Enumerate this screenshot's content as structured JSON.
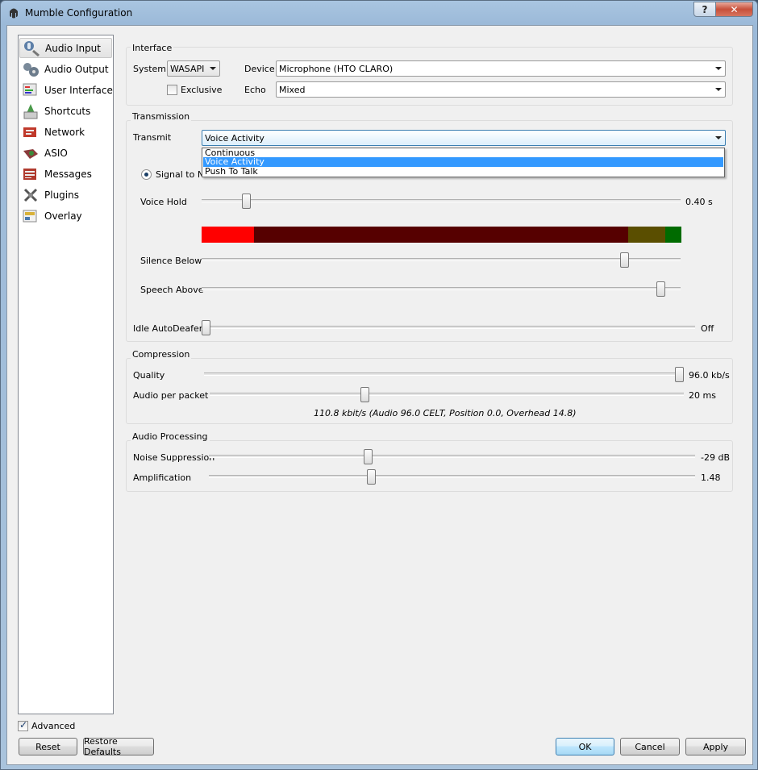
{
  "window": {
    "title": "Mumble Configuration",
    "help_glyph": "?",
    "close_glyph": "✕"
  },
  "sidebar": {
    "items": [
      {
        "label": "Audio Input",
        "icon": "audio-input-icon",
        "selected": true
      },
      {
        "label": "Audio Output",
        "icon": "audio-output-icon"
      },
      {
        "label": "User Interface",
        "icon": "user-interface-icon"
      },
      {
        "label": "Shortcuts",
        "icon": "shortcuts-icon"
      },
      {
        "label": "Network",
        "icon": "network-icon"
      },
      {
        "label": "ASIO",
        "icon": "asio-icon"
      },
      {
        "label": "Messages",
        "icon": "messages-icon"
      },
      {
        "label": "Plugins",
        "icon": "plugins-icon"
      },
      {
        "label": "Overlay",
        "icon": "overlay-icon"
      }
    ]
  },
  "interface": {
    "title": "Interface",
    "system_label": "System",
    "system_value": "WASAPI",
    "exclusive_label": "Exclusive",
    "exclusive_checked": false,
    "device_label": "Device",
    "device_value": "Microphone (HTO CLARO)",
    "echo_label": "Echo",
    "echo_value": "Mixed"
  },
  "transmission": {
    "title": "Transmission",
    "transmit_label": "Transmit",
    "transmit_value": "Voice Activity",
    "transmit_options": [
      "Continuous",
      "Voice Activity",
      "Push To Talk"
    ],
    "transmit_selected_index": 1,
    "signal_label": "Signal to No",
    "voice_hold_label": "Voice Hold",
    "voice_hold_value": "0.40 s",
    "silence_below_label": "Silence Below",
    "speech_above_label": "Speech Above",
    "idle_label": "Idle AutoDeafen",
    "idle_value": "Off",
    "meter_colors": {
      "active": "#ff0000",
      "silence": "#560000",
      "between": "#5a4e00",
      "speech": "#006b00"
    }
  },
  "compression": {
    "title": "Compression",
    "quality_label": "Quality",
    "quality_value": "96.0 kb/s",
    "packet_label": "Audio per packet",
    "packet_value": "20 ms",
    "summary": "110.8 kbit/s (Audio 96.0 CELT, Position 0.0, Overhead 14.8)"
  },
  "processing": {
    "title": "Audio Processing",
    "noise_label": "Noise Suppression",
    "noise_value": "-29 dB",
    "amp_label": "Amplification",
    "amp_value": "1.48"
  },
  "footer": {
    "advanced_label": "Advanced",
    "advanced_checked": true,
    "reset": "Reset",
    "restore": "Restore Defaults",
    "ok": "OK",
    "cancel": "Cancel",
    "apply": "Apply"
  }
}
